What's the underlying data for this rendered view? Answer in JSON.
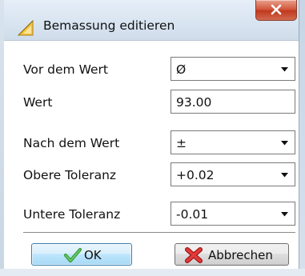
{
  "window": {
    "title": "Bemassung editieren",
    "title_icon": "dimension-triangle-icon",
    "close_icon": "close-icon"
  },
  "form": {
    "rows": [
      {
        "label": "Vor dem Wert",
        "value": "Ø",
        "type": "dropdown"
      },
      {
        "label": "Wert",
        "value": "93.00",
        "type": "text"
      },
      {
        "label": "Nach dem Wert",
        "value": "±",
        "type": "dropdown"
      },
      {
        "label": "Obere Toleranz",
        "value": "+0.02",
        "type": "dropdown"
      },
      {
        "label": "Untere Toleranz",
        "value": "-0.01",
        "type": "dropdown"
      }
    ]
  },
  "buttons": {
    "ok_label": "OK",
    "ok_icon": "checkmark-icon",
    "cancel_label": "Abbrechen",
    "cancel_icon": "red-x-icon"
  },
  "colors": {
    "ok_check": "#3aa23a",
    "cancel_x": "#d21f1f",
    "close_button": "#c7452a"
  }
}
